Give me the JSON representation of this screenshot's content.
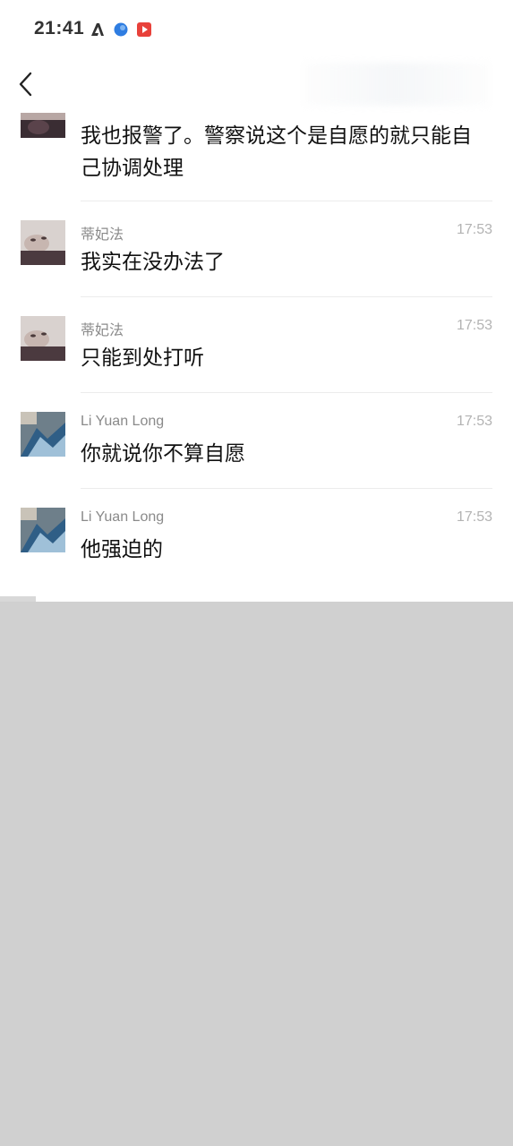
{
  "status_bar": {
    "time": "21:41",
    "icons": [
      "app-a-icon",
      "blue-circle-icon",
      "red-play-icon"
    ]
  },
  "nav": {
    "back_icon": "chevron-left-icon"
  },
  "messages": [
    {
      "sender": "",
      "time": "",
      "text": "我也报警了。警察说这个是自愿的就只能自己协调处理"
    },
    {
      "sender": "蒂妃法",
      "time": "17:53",
      "text": "我实在没办法了"
    },
    {
      "sender": "蒂妃法",
      "time": "17:53",
      "text": "只能到处打听"
    },
    {
      "sender": "Li Yuan Long",
      "time": "17:53",
      "text": "你就说你不算自愿"
    },
    {
      "sender": "Li Yuan Long",
      "time": "17:53",
      "text": "他强迫的"
    }
  ],
  "colors": {
    "background": "#ffffff",
    "sender": "#8a8a8a",
    "timestamp": "#b3b3b3",
    "redacted": "#d0d0d0"
  }
}
